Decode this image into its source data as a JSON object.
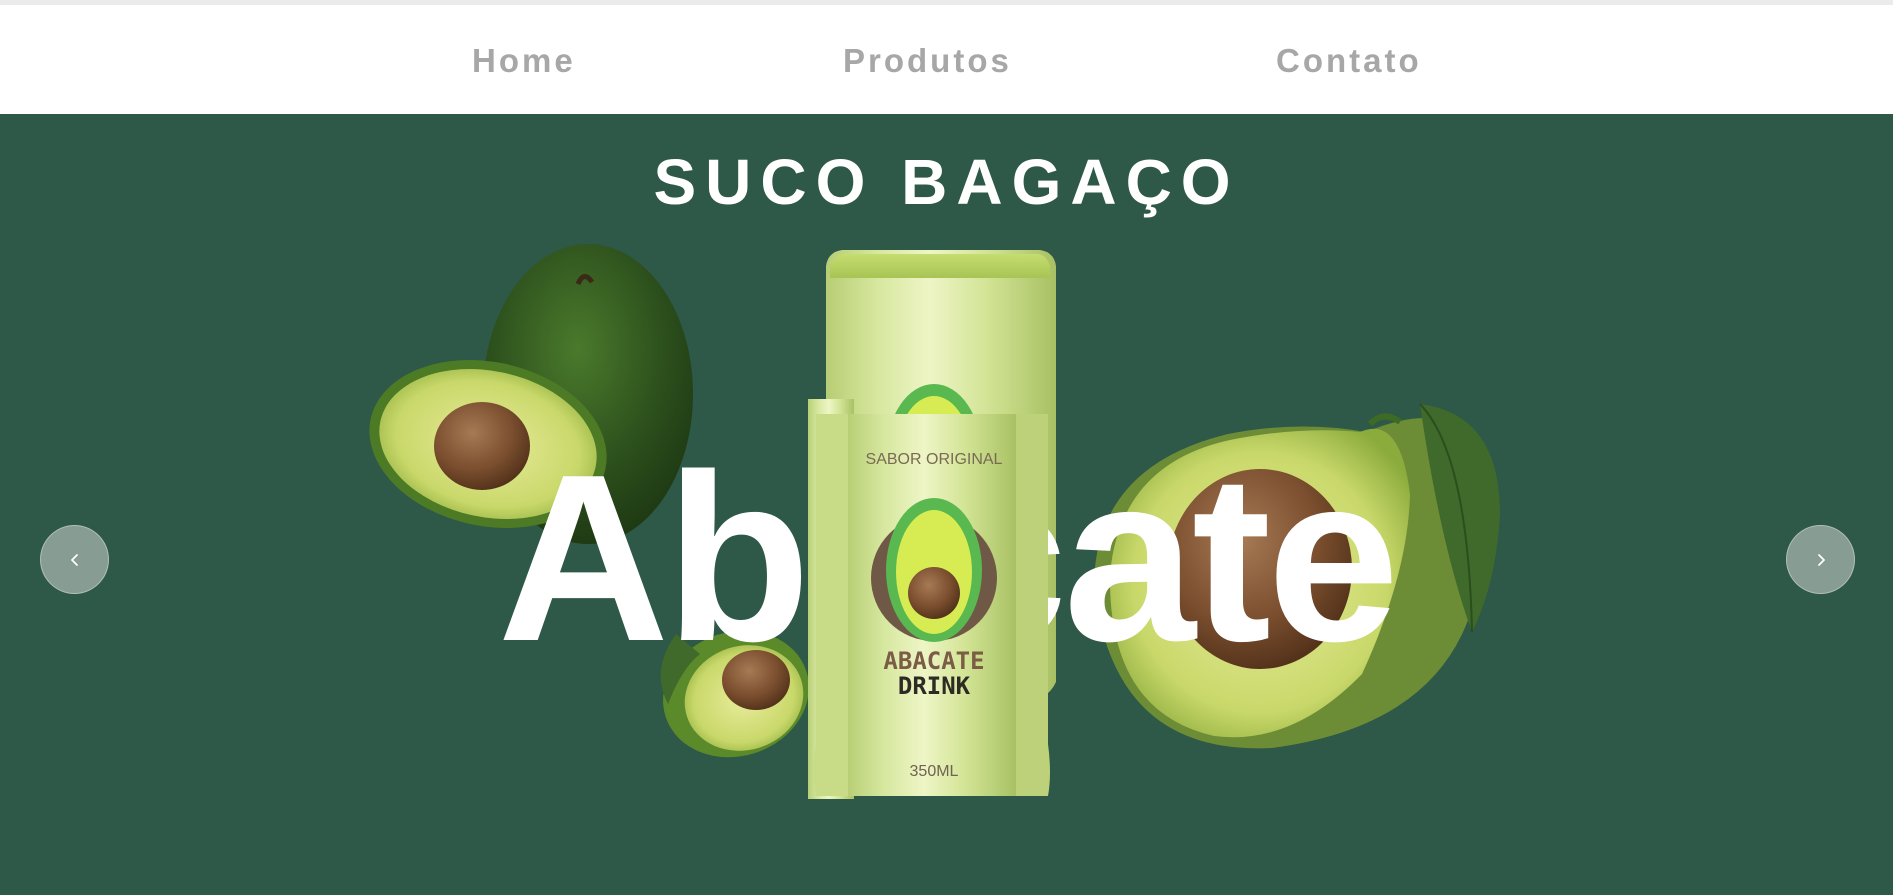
{
  "nav": {
    "items": [
      {
        "label": "Home"
      },
      {
        "label": "Produtos"
      },
      {
        "label": "Contato"
      }
    ]
  },
  "hero": {
    "brand": "SUCO BAGAÇO",
    "flavor_word": "Abacate",
    "prev_icon": "chevron-left-icon",
    "next_icon": "chevron-right-icon",
    "can": {
      "top_label": "SABOR ORIGINAL",
      "name_line1": "ABACATE",
      "name_line2": "DRINK",
      "volume": "350ML"
    }
  },
  "colors": {
    "background": "#2e5847",
    "nav_text": "#a7a7a7",
    "hero_text": "#ffffff",
    "can_body": "#d2e59a"
  }
}
